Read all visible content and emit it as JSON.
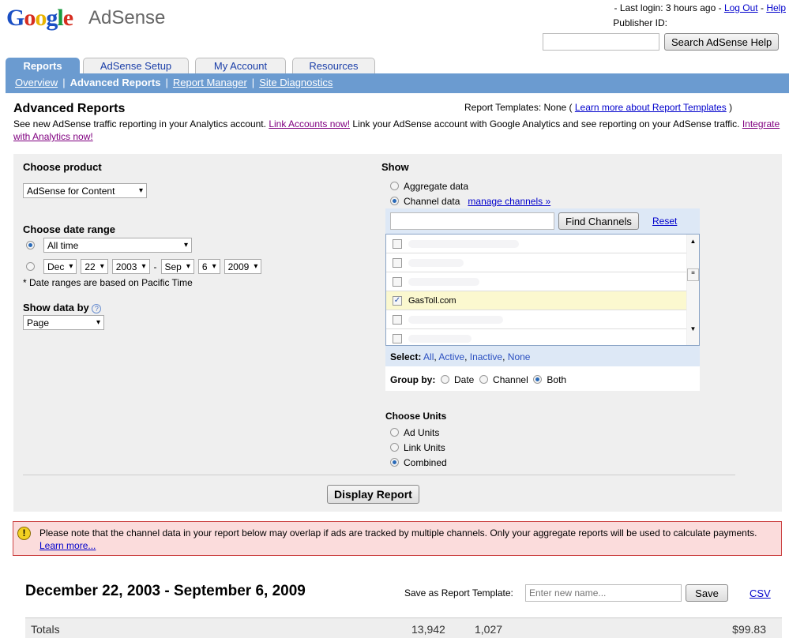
{
  "header": {
    "logo_google": "Google",
    "logo_product": "AdSense",
    "last_login": "- Last login: 3 hours ago -",
    "logout": "Log Out",
    "help": "Help",
    "publisher_label": "Publisher ID:",
    "search_button": "Search AdSense Help"
  },
  "tabs": [
    "Reports",
    "AdSense Setup",
    "My Account",
    "Resources"
  ],
  "subnav": [
    "Overview",
    "Advanced Reports",
    "Report Manager",
    "Site Diagnostics"
  ],
  "page": {
    "title": "Advanced Reports",
    "templates_label": "Report Templates:  None  (",
    "templates_link": "Learn more about Report Templates",
    "templates_close": ")",
    "intro_1": "See new AdSense traffic reporting in your Analytics account.",
    "link_accounts": "Link Accounts now!",
    "intro_2": "Link your AdSense account with Google Analytics and see reporting on your AdSense traffic.",
    "integrate": "Integrate with Analytics now!"
  },
  "form": {
    "product_label": "Choose product",
    "product_value": "AdSense for Content",
    "date_label": "Choose date range",
    "date_preset": "All time",
    "from_month": "Dec",
    "from_day": "22",
    "from_year": "2003",
    "dash": "-",
    "to_month": "Sep",
    "to_day": "6",
    "to_year": "2009",
    "date_note": "* Date ranges are based on Pacific Time",
    "showby_label": "Show data by",
    "showby_value": "Page",
    "show_label": "Show",
    "aggregate": "Aggregate data",
    "channel": "Channel data",
    "manage": "manage channels »",
    "find_button": "Find Channels",
    "reset": "Reset",
    "channels": [
      {
        "name": "",
        "checked": false
      },
      {
        "name": "",
        "checked": false
      },
      {
        "name": "",
        "checked": false
      },
      {
        "name": "GasToll.com",
        "checked": true
      },
      {
        "name": "",
        "checked": false
      },
      {
        "name": "",
        "checked": false
      }
    ],
    "select_label": "Select:",
    "select_opts": [
      "All",
      "Active",
      "Inactive",
      "None"
    ],
    "groupby_label": "Group by:",
    "groupby": [
      "Date",
      "Channel",
      "Both"
    ],
    "units_label": "Choose Units",
    "units": [
      "Ad Units",
      "Link Units",
      "Combined"
    ],
    "display_button": "Display Report"
  },
  "warning": {
    "text": "Please note that the channel data in your report below may overlap if ads are tracked by multiple channels. Only your aggregate reports will be used to calculate payments.",
    "link": "Learn more..."
  },
  "report": {
    "range": "December 22, 2003 - September 6, 2009",
    "save_label": "Save as Report Template:",
    "save_placeholder": "Enter new name...",
    "save_button": "Save",
    "csv": "CSV",
    "totals": {
      "label": "Totals",
      "impressions": "13,942",
      "clicks": "1,027",
      "earnings": "$99.83"
    }
  }
}
